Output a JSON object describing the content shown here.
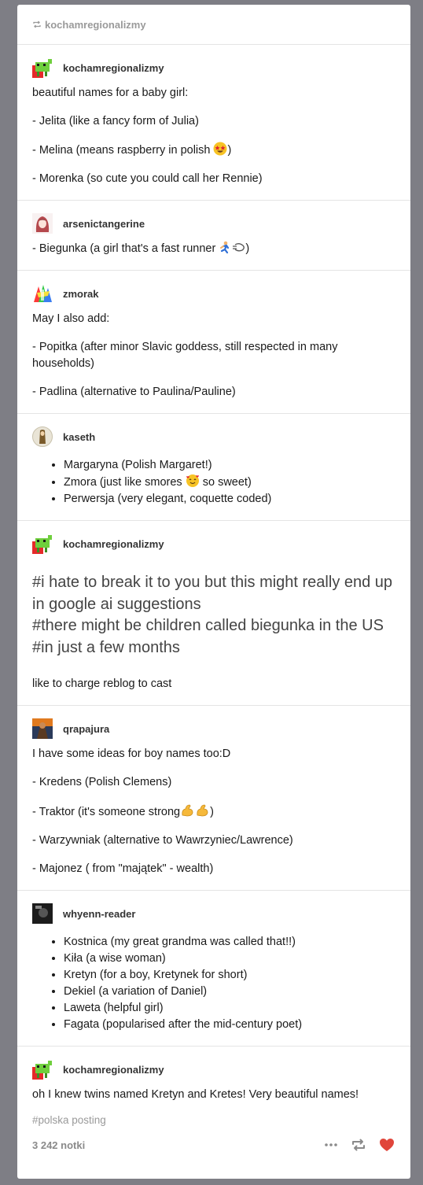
{
  "reblog_header": {
    "username": "kochamregionalizmy"
  },
  "posts": [
    {
      "username": "kochamregionalizmy",
      "lines": [
        "beautiful names for a baby girl:",
        "- Jelita (like a fancy form of Julia)",
        "- Melina (means raspberry in polish",
        "- Morenka (so cute you could call her Rennie)"
      ]
    },
    {
      "username": "arsenictangerine",
      "lines": [
        "- Biegunka (a girl that's a fast runner"
      ]
    },
    {
      "username": "zmorak",
      "lines": [
        "May I also add:",
        "- Popitka (after minor Slavic goddess, still respected in many households)",
        "- Padlina (alternative to Paulina/Pauline)"
      ]
    },
    {
      "username": "kaseth",
      "bullets": [
        "Margaryna (Polish Margaret!)",
        "Zmora (just like smores",
        "Perwersja (very elegant, coquette coded)"
      ],
      "bullet_suffix": "so sweet)"
    },
    {
      "username": "kochamregionalizmy",
      "tags": [
        "#i hate to break it to you but this might really end up in google ai suggestions",
        "#there might be children called biegunka in the US",
        "#in just a few months"
      ],
      "line": "like to charge reblog to cast"
    },
    {
      "username": "qrapajura",
      "lines": [
        "I have some ideas for boy names too:D",
        "- Kredens (Polish Clemens)",
        "- Traktor (it's someone strong",
        "- Warzywniak (alternative to Wawrzyniec/Lawrence)",
        "- Majonez ( from \"majątek\" - wealth)"
      ]
    },
    {
      "username": "whyenn-reader",
      "bullets": [
        "Kostnica (my great grandma was called that!!)",
        "Kiła (a wise woman)",
        "Kretyn (for a boy, Kretynek for short)",
        "Dekiel (a variation of Daniel)",
        "Laweta (helpful girl)",
        "Fagata (popularised after the mid-century poet)"
      ]
    },
    {
      "username": "kochamregionalizmy",
      "lines": [
        "oh I knew twins named Kretyn and Kretes! Very beautiful names!"
      ]
    }
  ],
  "footer": {
    "tag": "#polska posting",
    "notes": "3 242 notki"
  },
  "icons": {
    "reblog": "reblog-icon",
    "more": "more-dots-icon",
    "like": "heart-icon"
  },
  "colors": {
    "heart": "#e0453a",
    "muted": "#9a9a9a"
  }
}
